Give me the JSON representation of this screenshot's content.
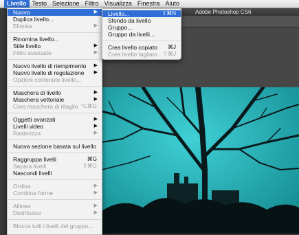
{
  "menubar": {
    "apple": "",
    "items": [
      "Livello",
      "Testo",
      "Selezione",
      "Filtro",
      "Visualizza",
      "Finestra",
      "Aiuto"
    ]
  },
  "app_title": "Adobe Photoshop CS6",
  "main_menu": [
    {
      "label": "Nuovo",
      "arrow": "▶",
      "state": "hl"
    },
    {
      "label": "Duplica livello...",
      "state": "normal"
    },
    {
      "label": "Elimina",
      "arrow": "▶",
      "state": "disabled"
    },
    {
      "label": "Rinomina livello...",
      "state": "normal"
    },
    {
      "label": "Stile livello",
      "arrow": "▶",
      "state": "normal"
    },
    {
      "label": "Filtro avanzato",
      "arrow": "▶",
      "state": "disabled"
    },
    {
      "label": "Nuovo livello di riempimento",
      "arrow": "▶",
      "state": "normal"
    },
    {
      "label": "Nuovo livello di regolazione",
      "arrow": "▶",
      "state": "normal"
    },
    {
      "label": "Opzioni contenuto livello...",
      "state": "disabled"
    },
    {
      "label": "Maschera di livello",
      "arrow": "▶",
      "state": "normal"
    },
    {
      "label": "Maschera vettoriale",
      "arrow": "▶",
      "state": "normal"
    },
    {
      "label": "Crea maschera di ritaglio",
      "shortcut": "⌥⌘G",
      "state": "disabled"
    },
    {
      "label": "Oggetti avanzati",
      "arrow": "▶",
      "state": "normal"
    },
    {
      "label": "Livelli video",
      "arrow": "▶",
      "state": "normal"
    },
    {
      "label": "Rasterizza",
      "arrow": "▶",
      "state": "disabled"
    },
    {
      "label": "Nuova sezione basata sul livello",
      "state": "normal"
    },
    {
      "label": "Raggruppa livelli",
      "shortcut": "⌘G",
      "state": "normal"
    },
    {
      "label": "Separa livelli",
      "shortcut": "⇧⌘G",
      "state": "disabled"
    },
    {
      "label": "Nascondi livelli",
      "state": "normal"
    },
    {
      "label": "Ordina",
      "arrow": "▶",
      "state": "disabled"
    },
    {
      "label": "Combina forme",
      "arrow": "▶",
      "state": "disabled"
    },
    {
      "label": "Allinea",
      "arrow": "▶",
      "state": "disabled"
    },
    {
      "label": "Distribuisci",
      "arrow": "▶",
      "state": "disabled"
    },
    {
      "label": "Blocca tutti i livelli del gruppo...",
      "state": "disabled"
    }
  ],
  "sub_menu": [
    {
      "label": "Livello...",
      "shortcut": "⇧⌘N",
      "state": "hl"
    },
    {
      "label": "Sfondo da livello",
      "state": "normal"
    },
    {
      "label": "Gruppo...",
      "state": "normal"
    },
    {
      "label": "Gruppo da livelli...",
      "state": "normal"
    },
    {
      "label": "Crea livello copiato",
      "shortcut": "⌘J",
      "state": "normal"
    },
    {
      "label": "Crea livello tagliato",
      "shortcut": "⇧⌘J",
      "state": "disabled"
    }
  ],
  "colors": {
    "highlight": "#2f6fd6",
    "canvas_tint": "#2fb9c0"
  }
}
